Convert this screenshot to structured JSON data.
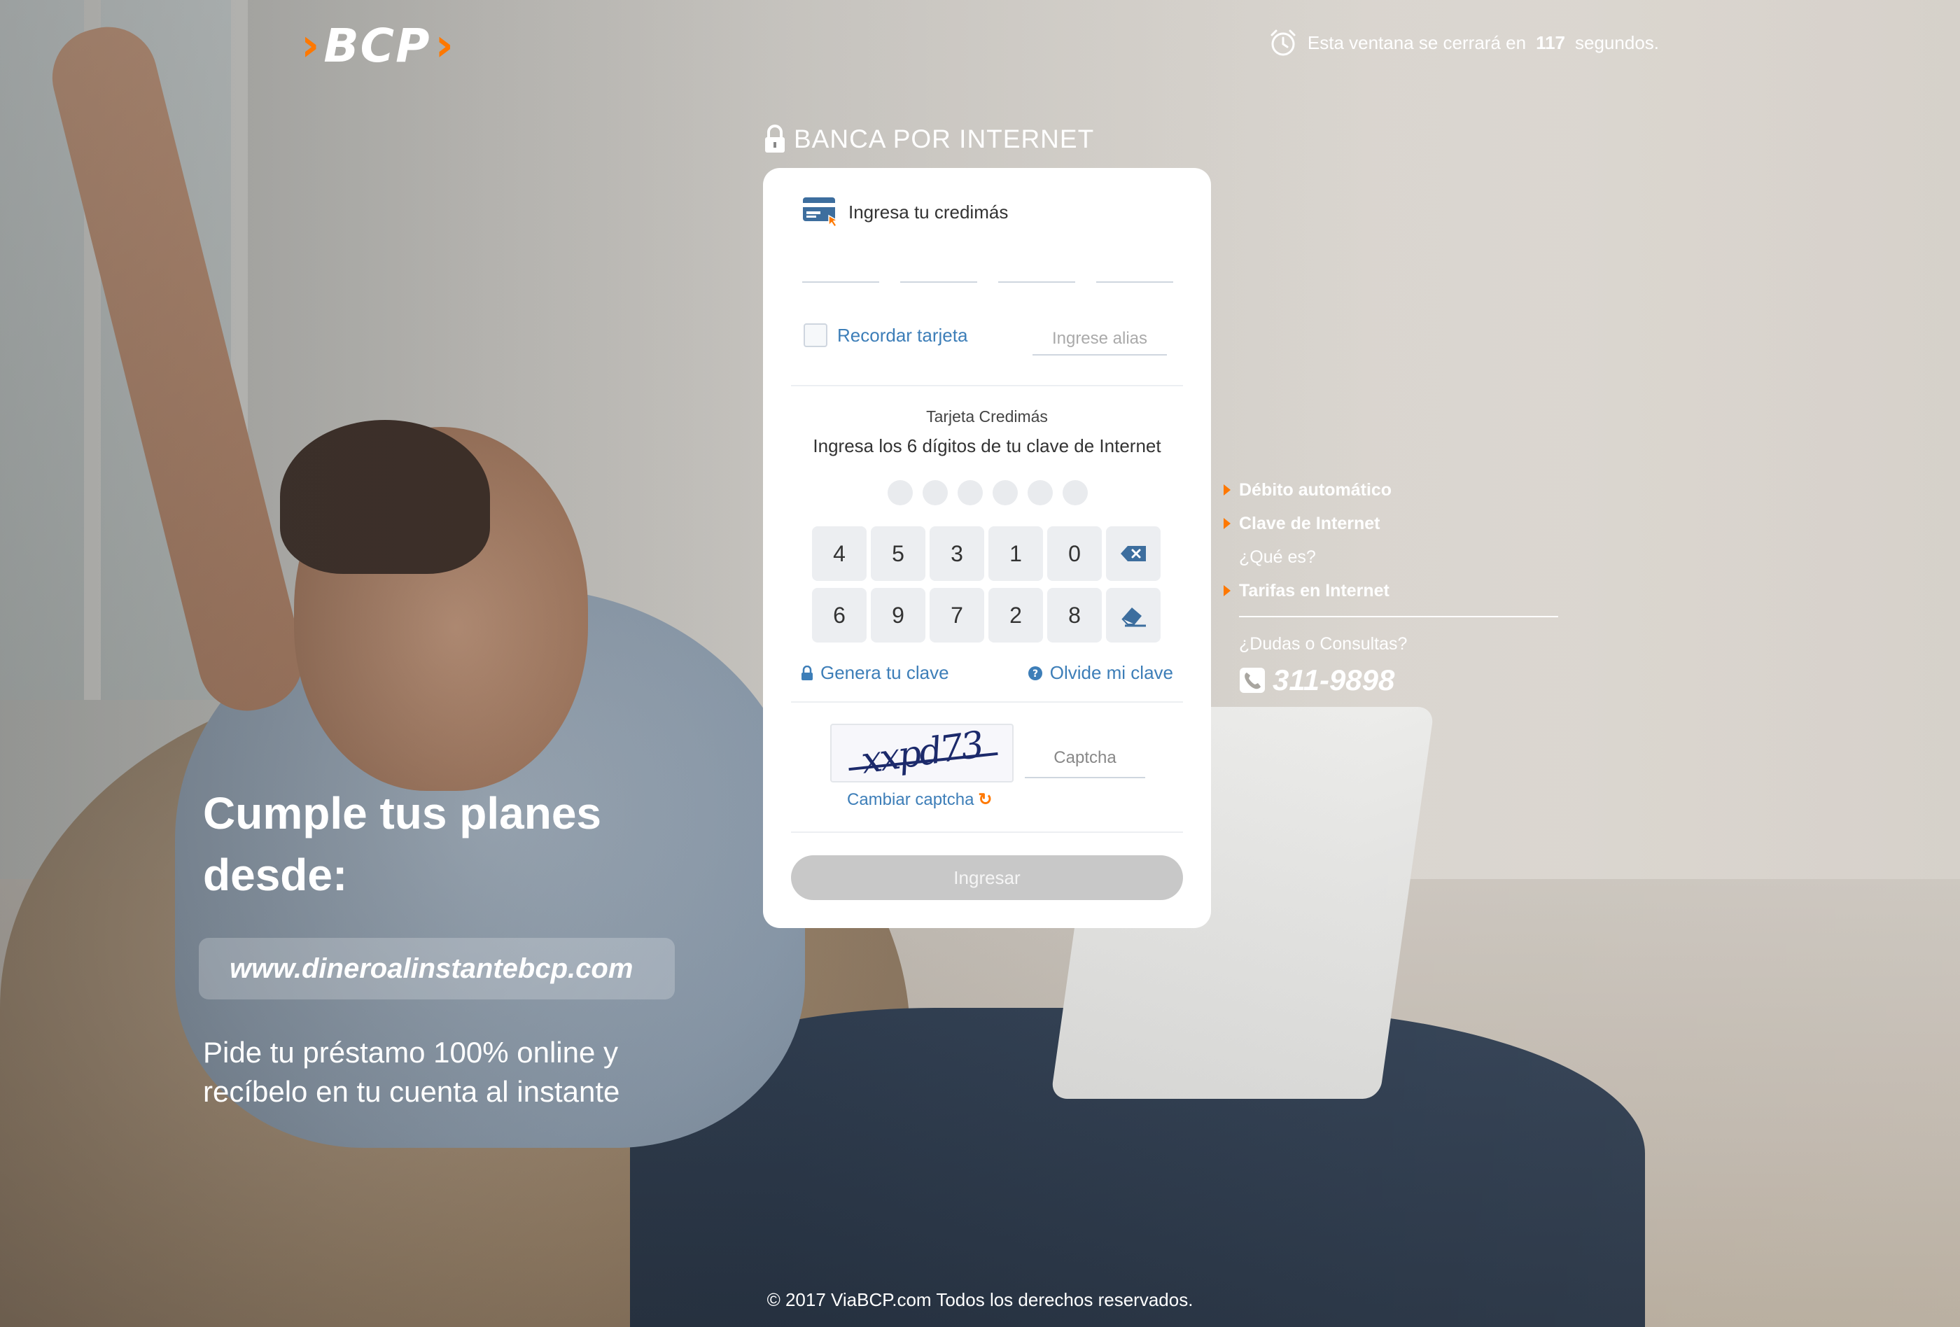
{
  "brand": {
    "logo_text": "BCP"
  },
  "header": {
    "timer_prefix": "Esta ventana se cerrará en",
    "timer_seconds": "117",
    "timer_suffix": "segundos."
  },
  "login": {
    "section_title": "BANCA POR INTERNET",
    "card_prompt": "Ingresa tu credimás",
    "remember_label": "Recordar tarjeta",
    "alias_placeholder": "Ingrese alias",
    "card_type": "Tarjeta Credimás",
    "pin_prompt": "Ingresa los 6 dígitos de tu clave de Internet",
    "pin_dots_filled": 0,
    "keypad_row1": [
      "4",
      "5",
      "3",
      "1",
      "0"
    ],
    "keypad_row2": [
      "6",
      "9",
      "7",
      "2",
      "8"
    ],
    "generate_link": "Genera tu clave",
    "forgot_link": "Olvide mi clave",
    "captcha_text": "xxpd73",
    "captcha_placeholder": "Captcha",
    "change_captcha": "Cambiar captcha",
    "submit_label": "Ingresar"
  },
  "side_menu": {
    "item1": "Débito automático",
    "item2": "Clave de Internet",
    "item2_sub": "¿Qué es?",
    "item3": "Tarifas en Internet",
    "help_label": "¿Dudas o Consultas?",
    "phone": "311-9898"
  },
  "promo": {
    "headline": "Cumple tus planes desde:",
    "url": "www.dineroalinstantebcp.com",
    "description": "Pide tu préstamo 100% online y recíbelo en tu cuenta al instante"
  },
  "footer": {
    "copyright": "© 2017 ViaBCP.com Todos los derechos reservados."
  },
  "colors": {
    "accent": "#ff7800",
    "link": "#3d7eb8",
    "disabled_button": "#c8c8c8"
  }
}
